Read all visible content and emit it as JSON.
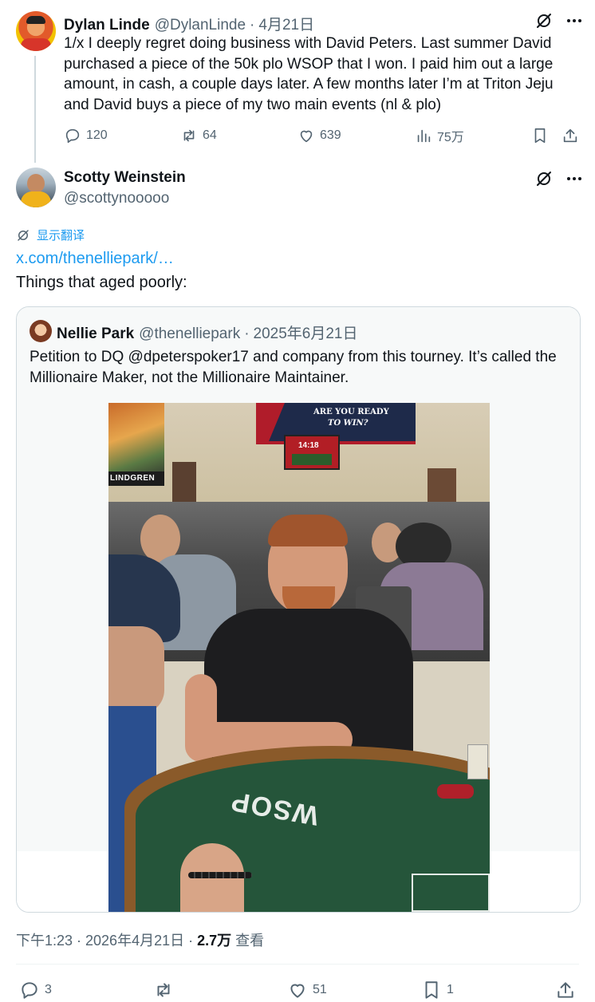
{
  "parent_tweet": {
    "author_name": "Dylan Linde",
    "handle": "@DylanLinde",
    "date": "4月21日",
    "text": "1/x I deeply regret doing business with David Peters.  Last summer David purchased a piece of the 50k plo WSOP that I won.  I paid him out a large amount, in cash, a couple days later.  A few months later I’m at Triton Jeju and David buys a piece of my two main events (nl & plo)",
    "replies": "120",
    "reposts": "64",
    "likes": "639",
    "views": "75万"
  },
  "reply_tweet": {
    "author_name": "Scotty Weinstein",
    "handle": "@scottynooooo",
    "translate_label": "显示翻译",
    "link_text": "x.com/thenelliepark/…",
    "text": "Things that aged poorly:",
    "timestamp": "下午1:23 · 2026年4月21日 ·",
    "views_count": "2.7万",
    "views_label": "查看",
    "replies": "3",
    "likes": "51",
    "bookmarks": "1"
  },
  "quoted_tweet": {
    "author_name": "Nellie Park",
    "handle": "@thenelliepark",
    "date": "2025年6月21日",
    "text": "Petition to DQ @dpeterspoker17 and company from this tourney. It’s called the Millionaire Maker, not the Millionaire Maintainer.",
    "photo": {
      "banner_text_1": "ARE YOU READY",
      "banner_text_2": "TO WIN?",
      "clock": "14:18",
      "sign": "LINDGREN",
      "table_logo": "WSOP"
    }
  },
  "icons": {
    "grok": "grok-icon",
    "more": "more-icon",
    "reply": "reply-icon",
    "repost": "repost-icon",
    "like": "heart-icon",
    "views": "views-icon",
    "bookmark": "bookmark-icon",
    "share": "share-icon",
    "translate": "translate-icon"
  },
  "colors": {
    "link": "#1d9bf0",
    "muted": "#536471",
    "text": "#0f1419",
    "border": "#cfd9de"
  }
}
